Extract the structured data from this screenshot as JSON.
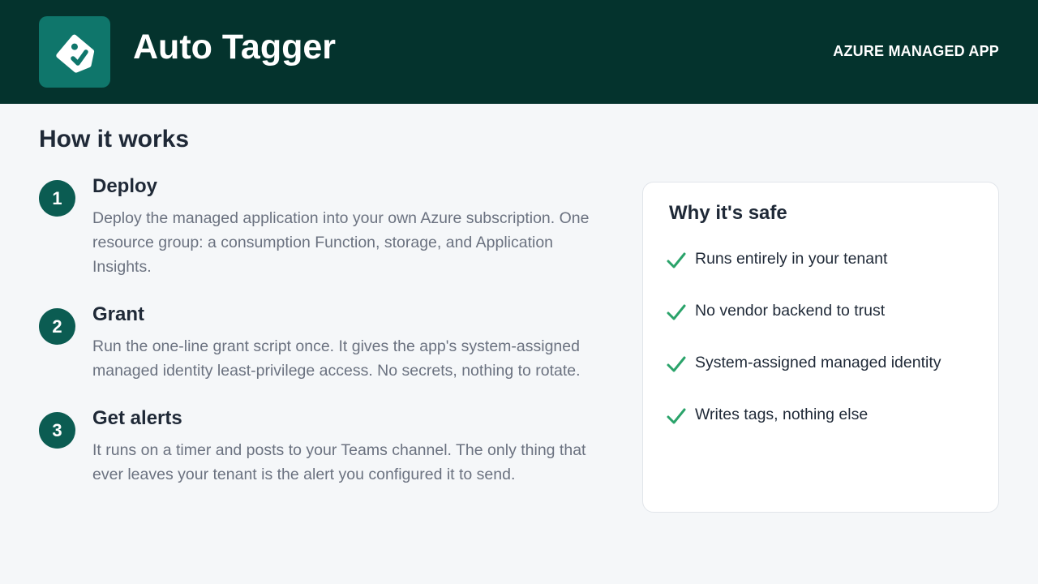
{
  "header": {
    "title": "Auto Tagger",
    "badge": "AZURE MANAGED APP",
    "logo_icon": "tag-check-icon"
  },
  "how_it_works": {
    "title": "How it works",
    "steps": [
      {
        "number": "1",
        "title": "Deploy",
        "description": "Deploy the managed application into your own Azure subscription. One resource group: a consumption Function, storage, and Application Insights."
      },
      {
        "number": "2",
        "title": "Grant",
        "description": "Run the one-line grant script once. It gives the app's system-assigned managed identity least-privilege access. No secrets, nothing to rotate."
      },
      {
        "number": "3",
        "title": "Get alerts",
        "description": "It runs on a timer and posts to your Teams channel. The only thing that ever leaves your tenant is the alert you configured it to send."
      }
    ]
  },
  "safety": {
    "title": "Why it's safe",
    "items": [
      "Runs entirely in your tenant",
      "No vendor backend to trust",
      "System-assigned managed identity",
      "Writes tags, nothing else"
    ]
  },
  "colors": {
    "header_bg": "#04332d",
    "logo_bg": "#0f766b",
    "step_badge": "#0b5c52",
    "check": "#2aa36a",
    "page_bg": "#f5f7f9"
  }
}
